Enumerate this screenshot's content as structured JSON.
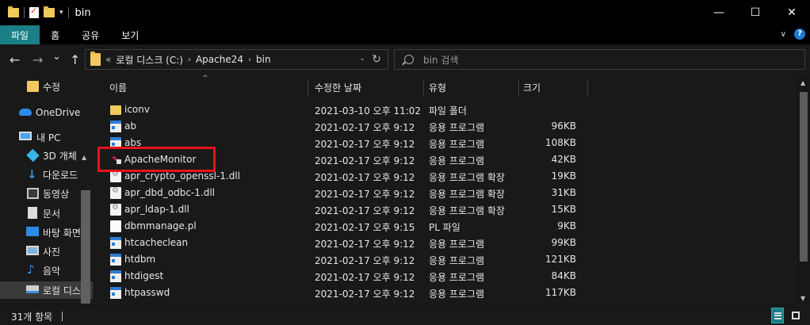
{
  "window": {
    "title": "bin",
    "minimize_glyph": "—",
    "maximize_glyph": "☐",
    "close_glyph": "✕",
    "qa_dropdown_glyph": "▾"
  },
  "ribbon": {
    "tabs": [
      {
        "label": "파일",
        "active": true
      },
      {
        "label": "홈",
        "active": false
      },
      {
        "label": "공유",
        "active": false
      },
      {
        "label": "보기",
        "active": false
      }
    ],
    "collapse_glyph": "∨",
    "help_glyph": "?"
  },
  "nav": {
    "back_glyph": "←",
    "forward_glyph": "→",
    "recent_glyph": "⌄",
    "up_glyph": "↑",
    "address": {
      "overflow": "«",
      "crumbs": [
        "로컬 디스크 (C:)",
        "Apache24",
        "bin"
      ],
      "sep_glyph": "›",
      "dropdown_glyph": "⌄",
      "refresh_glyph": "↻"
    },
    "search": {
      "placeholder": "bin 검색"
    }
  },
  "sidebar": {
    "items": [
      {
        "label": "수정",
        "icon": "folder-icon",
        "selected": false
      },
      {
        "label": "OneDrive",
        "icon": "cloud-icon",
        "selected": false
      },
      {
        "label": "내 PC",
        "icon": "pc-icon",
        "selected": false
      },
      {
        "label": "3D 개체",
        "icon": "cube-icon",
        "selected": false
      },
      {
        "label": "다운로드",
        "icon": "download-icon",
        "selected": false
      },
      {
        "label": "동영상",
        "icon": "video-icon",
        "selected": false
      },
      {
        "label": "문서",
        "icon": "document-icon",
        "selected": false
      },
      {
        "label": "바탕 화면",
        "icon": "desktop-icon",
        "selected": false
      },
      {
        "label": "사진",
        "icon": "pictures-icon",
        "selected": false
      },
      {
        "label": "음악",
        "icon": "music-icon",
        "selected": false
      },
      {
        "label": "로컬 디스",
        "icon": "drive-icon",
        "selected": true
      }
    ],
    "scroll_up_glyph": "▲"
  },
  "columns": {
    "name": "이름",
    "date": "수정한 날짜",
    "type": "유형",
    "size": "크기",
    "sort_glyph": "^"
  },
  "files": [
    {
      "name": "iconv",
      "date": "2021-03-10 오후 11:02",
      "type": "파일 폴더",
      "size": "",
      "icon": "folder"
    },
    {
      "name": "ab",
      "date": "2021-02-17 오후 9:12",
      "type": "응용 프로그램",
      "size": "96KB",
      "icon": "exe"
    },
    {
      "name": "abs",
      "date": "2021-02-17 오후 9:12",
      "type": "응용 프로그램",
      "size": "108KB",
      "icon": "exe"
    },
    {
      "name": "ApacheMonitor",
      "date": "2021-02-17 오후 9:12",
      "type": "응용 프로그램",
      "size": "42KB",
      "icon": "apache"
    },
    {
      "name": "apr_crypto_openssl-1.dll",
      "date": "2021-02-17 오후 9:12",
      "type": "응용 프로그램 확장",
      "size": "19KB",
      "icon": "dll"
    },
    {
      "name": "apr_dbd_odbc-1.dll",
      "date": "2021-02-17 오후 9:12",
      "type": "응용 프로그램 확장",
      "size": "31KB",
      "icon": "dll"
    },
    {
      "name": "apr_ldap-1.dll",
      "date": "2021-02-17 오후 9:12",
      "type": "응용 프로그램 확장",
      "size": "15KB",
      "icon": "dll"
    },
    {
      "name": "dbmmanage.pl",
      "date": "2021-02-17 오후 9:15",
      "type": "PL 파일",
      "size": "9KB",
      "icon": "doc"
    },
    {
      "name": "htcacheclean",
      "date": "2021-02-17 오후 9:12",
      "type": "응용 프로그램",
      "size": "99KB",
      "icon": "exe"
    },
    {
      "name": "htdbm",
      "date": "2021-02-17 오후 9:12",
      "type": "응용 프로그램",
      "size": "121KB",
      "icon": "exe"
    },
    {
      "name": "htdigest",
      "date": "2021-02-17 오후 9:12",
      "type": "응용 프로그램",
      "size": "84KB",
      "icon": "exe"
    },
    {
      "name": "htpasswd",
      "date": "2021-02-17 오후 9:12",
      "type": "응용 프로그램",
      "size": "117KB",
      "icon": "exe"
    }
  ],
  "highlighted_file": "ApacheMonitor",
  "scroll": {
    "up_glyph": "▲",
    "down_glyph": "▼"
  },
  "status": {
    "item_count": "31개 항목"
  }
}
